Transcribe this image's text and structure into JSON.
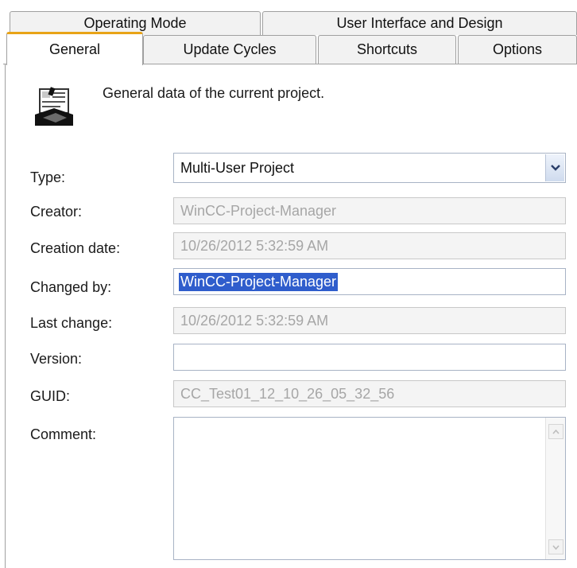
{
  "tabs_row1": [
    "Operating Mode",
    "User Interface and Design"
  ],
  "tabs_row2": [
    "General",
    "Update Cycles",
    "Shortcuts",
    "Options"
  ],
  "active_tab": "General",
  "description": "General data of the current project.",
  "fields": {
    "type": {
      "label": "Type:",
      "value": "Multi-User Project"
    },
    "creator": {
      "label": "Creator:",
      "value": "WinCC-Project-Manager"
    },
    "creation_date": {
      "label": "Creation date:",
      "value": "10/26/2012 5:32:59 AM"
    },
    "changed_by": {
      "label": "Changed by:",
      "value": "WinCC-Project-Manager"
    },
    "last_change": {
      "label": "Last change:",
      "value": "10/26/2012 5:32:59 AM"
    },
    "version": {
      "label": "Version:",
      "value": ""
    },
    "guid": {
      "label": "GUID:",
      "value": "CC_Test01_12_10_26_05_32_56"
    },
    "comment": {
      "label": "Comment:",
      "value": ""
    }
  },
  "icons": {
    "project": "project-properties-icon",
    "dropdown": "chevron-down-icon"
  },
  "colors": {
    "active_tab_accent": "#e8a317",
    "selection": "#2f5dcc",
    "readonly_text": "#a6a6a6"
  }
}
